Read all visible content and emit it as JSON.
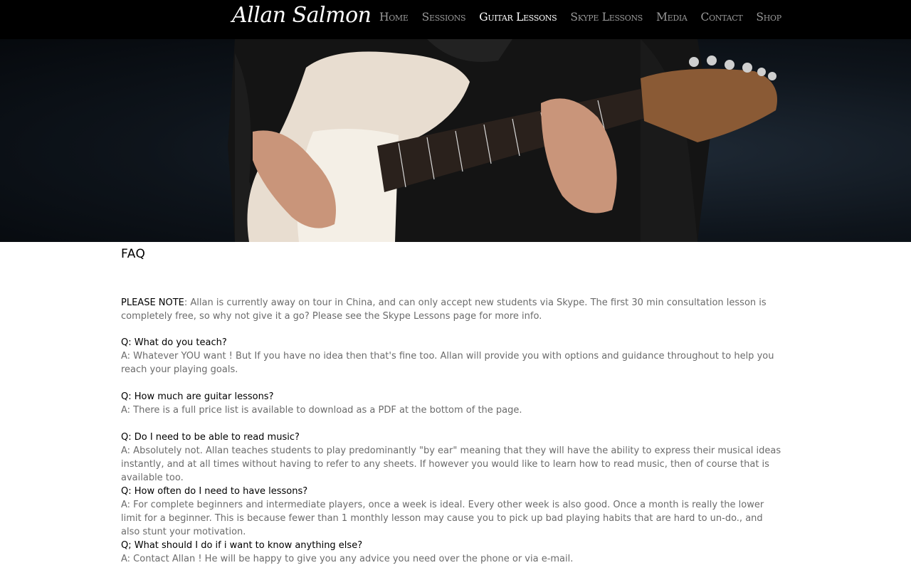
{
  "site": {
    "logo": "Allan Salmon"
  },
  "nav": {
    "items": [
      {
        "label": "Home"
      },
      {
        "label": "Sessions"
      },
      {
        "label": "Guitar Lessons"
      },
      {
        "label": "Skype Lessons"
      },
      {
        "label": "Media"
      },
      {
        "label": "Contact"
      },
      {
        "label": "Shop"
      }
    ],
    "active": "Guitar Lessons"
  },
  "colors": {
    "topbar": "#000000",
    "nav_inactive": "#9a9a9a",
    "nav_active": "#ffffff",
    "body_text": "#6b6b6b",
    "question_text": "#000000"
  },
  "faq": {
    "title": "FAQ",
    "note_label": "PLEASE NOTE",
    "note_text": ": Allan is currently away on tour in China, and can only accept new students via Skype. The first 30 min consultation lesson is completely free, so why not give it a go? Please see the Skype Lessons page for more info.",
    "items": [
      {
        "q": "Q: What do you teach?",
        "a": "A: Whatever YOU want ! But If you have no idea then that's fine too. Allan will provide you with options and guidance throughout to help you reach your playing goals."
      },
      {
        "q": "Q: How much are guitar lessons?",
        "a": "A: There is a full price list is available to download as a PDF at the bottom of the page."
      },
      {
        "q": "Q: Do I need to be able to read music?",
        "a": "A: Absolutely not. Allan teaches students to play predominantly \"by ear\" meaning that they will have the ability to express their musical ideas instantly, and at all times without having to refer to any sheets. If however you would like to learn how to read music, then of course that is available too."
      },
      {
        "q": "Q: How often do I need to have lessons?",
        "a": "A: For complete beginners and intermediate players, once a week is ideal. Every other week is also good. Once a month is really the lower limit for a beginner. This is because fewer than 1 monthly lesson may cause you to pick up bad playing habits that are hard to un-do., and also stunt your motivation."
      },
      {
        "q": "Q; What should I do if i want to know anything else?",
        "a": "A: Contact Allan ! He will be happy to give you any advice you need over the phone or via e-mail."
      }
    ]
  }
}
